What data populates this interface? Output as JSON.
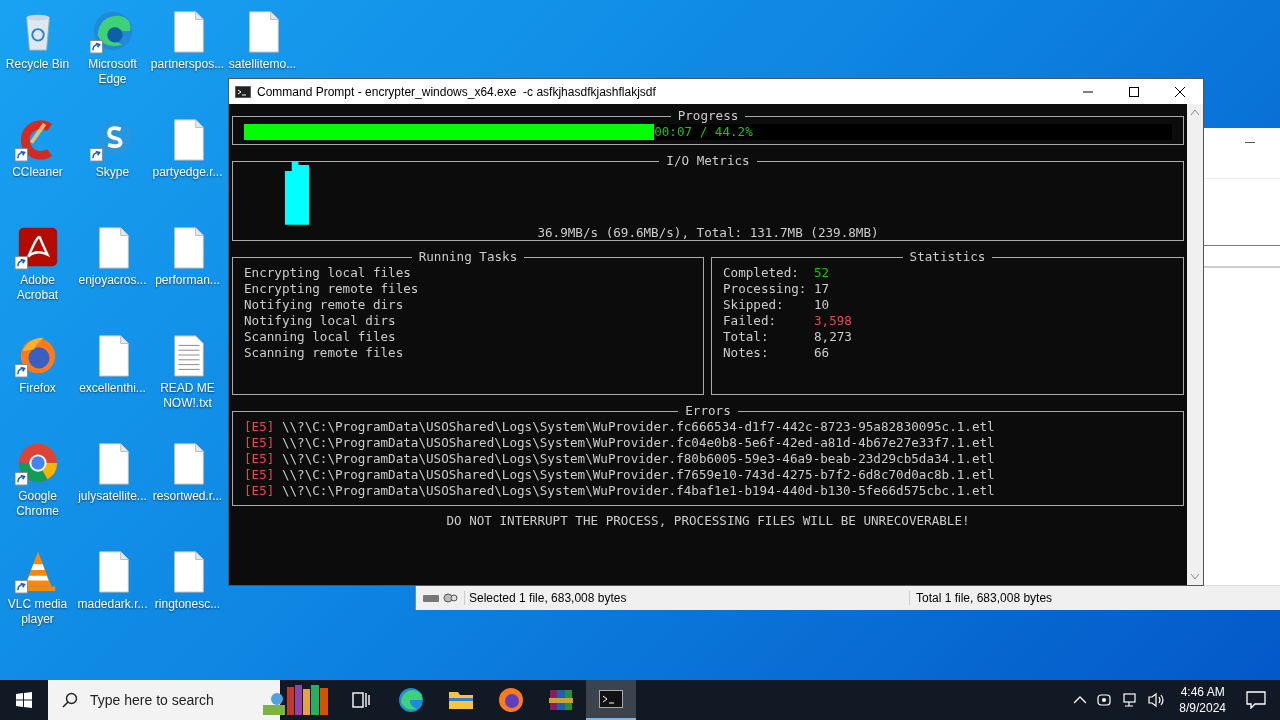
{
  "desktop": {
    "icons": [
      {
        "label": "Recycle Bin",
        "kind": "recycle",
        "shortcut": false
      },
      {
        "label": "CCleaner",
        "kind": "ccleaner",
        "shortcut": true
      },
      {
        "label": "Adobe Acrobat",
        "kind": "pdf",
        "shortcut": true
      },
      {
        "label": "Firefox",
        "kind": "firefox",
        "shortcut": true
      },
      {
        "label": "Google Chrome",
        "kind": "chrome",
        "shortcut": true
      },
      {
        "label": "VLC media player",
        "kind": "cone",
        "shortcut": true
      },
      {
        "label": "Microsoft Edge",
        "kind": "edge",
        "shortcut": true
      },
      {
        "label": "Skype",
        "kind": "skype",
        "shortcut": true
      },
      {
        "label": "enjoyacros...",
        "kind": "file",
        "shortcut": false
      },
      {
        "label": "excellenthi...",
        "kind": "file",
        "shortcut": false
      },
      {
        "label": "julysatellite...",
        "kind": "file",
        "shortcut": false
      },
      {
        "label": "madedark.r...",
        "kind": "file",
        "shortcut": false
      },
      {
        "label": "partnerspos...",
        "kind": "file",
        "shortcut": false
      },
      {
        "label": "partyedge.r...",
        "kind": "file",
        "shortcut": false
      },
      {
        "label": "performan...",
        "kind": "file",
        "shortcut": false
      },
      {
        "label": "READ ME NOW!.txt",
        "kind": "text",
        "shortcut": false
      },
      {
        "label": "resortwed.r...",
        "kind": "file",
        "shortcut": false
      },
      {
        "label": "ringtonesc...",
        "kind": "file",
        "shortcut": false
      },
      {
        "label": "satellitemo...",
        "kind": "file",
        "shortcut": false
      }
    ]
  },
  "background_window": {
    "status_bar": {
      "selected": "Selected 1 file, 683,008 bytes",
      "total": "Total 1 file, 683,008 bytes"
    }
  },
  "console": {
    "title": "Command Prompt - encrypter_windows_x64.exe  -c asfkjhasdfkjashflakjsdf",
    "progress": {
      "title": "Progress",
      "level": 0.442,
      "reading": "00:07 / 44.2%"
    },
    "io_metrics": {
      "title": "I/O Metrics",
      "summary": "36.9MB/s (69.6MB/s), Total: 131.7MB (239.8MB)"
    },
    "running_tasks": {
      "title": "Running Tasks",
      "items": [
        "Encrypting local files",
        "Encrypting remote files",
        "Notifying remote dirs",
        "Notifying local dirs",
        "Scanning local files",
        "Scanning remote files"
      ]
    },
    "statistics": {
      "title": "Statistics",
      "rows": [
        {
          "label": "Completed:",
          "value": "52",
          "color": "#16c60c"
        },
        {
          "label": "Processing:",
          "value": "17",
          "color": "#cccccc"
        },
        {
          "label": "Skipped:",
          "value": "10",
          "color": "#cccccc"
        },
        {
          "label": "Failed:",
          "value": "3,598",
          "color": "#e74856"
        },
        {
          "label": "Total:",
          "value": "8,273",
          "color": "#cccccc"
        },
        {
          "label": "Notes:",
          "value": "66",
          "color": "#cccccc"
        }
      ]
    },
    "errors": {
      "title": "Errors",
      "rows": [
        {
          "code": "[E5]",
          "path": "\\\\?\\C:\\ProgramData\\USOShared\\Logs\\System\\WuProvider.fc666534-d1f7-442c-8723-95a82830095c.1.etl"
        },
        {
          "code": "[E5]",
          "path": "\\\\?\\C:\\ProgramData\\USOShared\\Logs\\System\\WuProvider.fc04e0b8-5e6f-42ed-a81d-4b67e27e33f7.1.etl"
        },
        {
          "code": "[E5]",
          "path": "\\\\?\\C:\\ProgramData\\USOShared\\Logs\\System\\WuProvider.f80b6005-59e3-46a9-beab-23d29cb5da34.1.etl"
        },
        {
          "code": "[E5]",
          "path": "\\\\?\\C:\\ProgramData\\USOShared\\Logs\\System\\WuProvider.f7659e10-743d-4275-b7f2-6d8c70d0ac8b.1.etl"
        },
        {
          "code": "[E5]",
          "path": "\\\\?\\C:\\ProgramData\\USOShared\\Logs\\System\\WuProvider.f4baf1e1-b194-440d-b130-5fe66d575cbc.1.etl"
        }
      ]
    },
    "warning": "DO NOT INTERRUPT THE PROCESS, PROCESSING FILES WILL BE UNRECOVERABLE!"
  },
  "taskbar": {
    "search": {
      "placeholder": "Type here to search"
    },
    "apps": [
      {
        "kind": "books",
        "selected": false
      },
      {
        "kind": "taskview",
        "selected": false
      },
      {
        "kind": "edge",
        "selected": false
      },
      {
        "kind": "folder",
        "selected": false
      },
      {
        "kind": "firefox",
        "selected": false
      },
      {
        "kind": "archive",
        "selected": false
      },
      {
        "kind": "console",
        "selected": true
      }
    ],
    "clock": {
      "time": "4:46 AM",
      "date": "8/9/2024"
    }
  }
}
